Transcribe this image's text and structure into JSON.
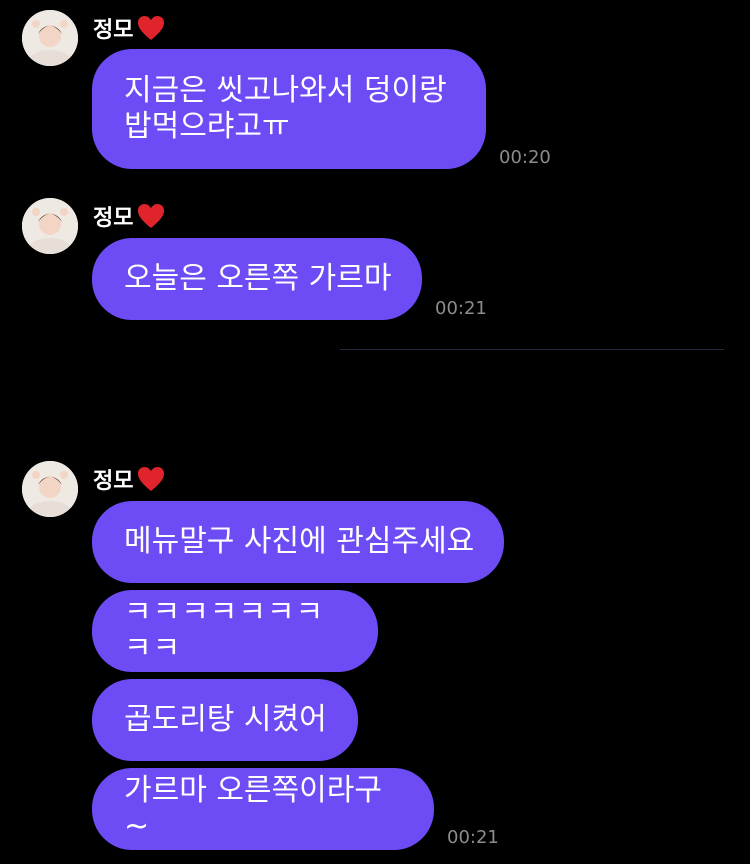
{
  "theme": {
    "bubble_color": "#6d4cf6",
    "background": "#000000",
    "time_color": "#8c8c8c"
  },
  "groups": [
    {
      "sender": "정모",
      "heart_icon": "red-heart-icon",
      "messages": [
        "지금은 씻고나와서 덩이랑 밥먹으랴고ㅠ"
      ],
      "time": "00:20"
    },
    {
      "sender": "정모",
      "heart_icon": "red-heart-icon",
      "messages": [
        "오늘은 오른쪽 가르마"
      ],
      "time": "00:21"
    },
    {
      "sender": "정모",
      "heart_icon": "red-heart-icon",
      "messages": [
        "메뉴말구 사진에 관심주세요",
        "ㅋㅋㅋㅋㅋㅋㅋㅋㅋ",
        "곱도리탕 시켰어",
        "가르마 오른쪽이라구~"
      ],
      "time": "00:21"
    }
  ],
  "line_breaks": {
    "first_message_line1": "지금은 씻고나와서 덩이랑",
    "first_message_line2": "밥먹으랴고ㅠ"
  }
}
